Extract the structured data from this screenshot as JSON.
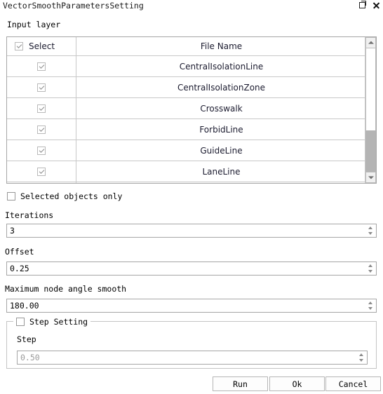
{
  "window": {
    "title": "VectorSmoothParametersSetting",
    "restore_icon": "restore-window-icon",
    "close_icon": "close-icon"
  },
  "input_layer": {
    "label": "Input layer",
    "table": {
      "columns": [
        "Select",
        "File Name"
      ],
      "header_checkbox_checked": true,
      "rows": [
        {
          "selected": true,
          "file_name": "CentralIsolationLine"
        },
        {
          "selected": true,
          "file_name": "CentralIsolationZone"
        },
        {
          "selected": true,
          "file_name": "Crosswalk"
        },
        {
          "selected": true,
          "file_name": "ForbidLine"
        },
        {
          "selected": true,
          "file_name": "GuideLine"
        },
        {
          "selected": true,
          "file_name": "LaneLine"
        }
      ],
      "scrollbar": {
        "up_icon": "scroll-up-arrow-icon",
        "down_icon": "scroll-down-arrow-icon"
      }
    }
  },
  "options": {
    "selected_objects_only": {
      "label": "Selected objects only",
      "checked": false
    }
  },
  "fields": {
    "iterations": {
      "label": "Iterations",
      "value": "3"
    },
    "offset": {
      "label": "Offset",
      "value": "0.25"
    },
    "max_node_angle": {
      "label": "Maximum node angle smooth",
      "value": "180.00"
    }
  },
  "step_setting": {
    "title": "Step Setting",
    "checked": false,
    "step": {
      "label": "Step",
      "value": "0.50",
      "disabled": true
    }
  },
  "buttons": {
    "run": "Run",
    "ok": "Ok",
    "cancel": "Cancel"
  }
}
